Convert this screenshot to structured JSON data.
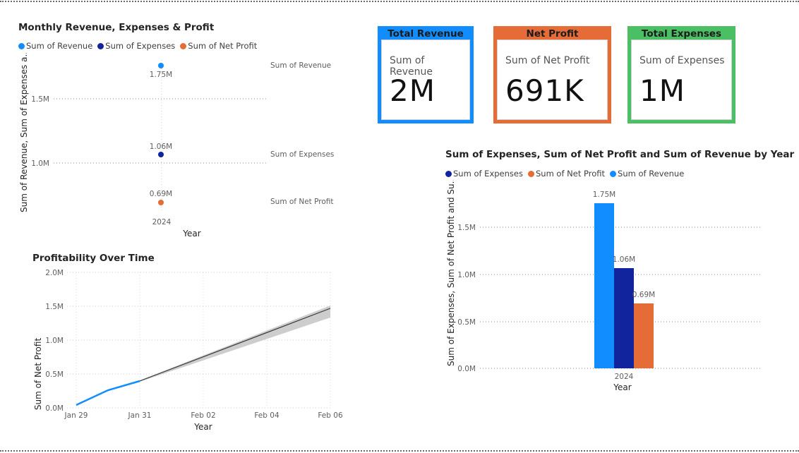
{
  "cards": [
    {
      "title": "Total Revenue",
      "subtitle": "Sum of Revenue",
      "value": "2M",
      "color": "#118dff"
    },
    {
      "title": "Net Profit",
      "subtitle": "Sum of Net Profit",
      "value": "691K",
      "color": "#e66c37"
    },
    {
      "title": "Total Expenses",
      "subtitle": "Sum of Expenses",
      "value": "1M",
      "color": "#4bbf64"
    }
  ],
  "colors": {
    "revenue": "#118dff",
    "expenses": "#12239e",
    "profit": "#e66c37",
    "trend": "#3a3a3a"
  },
  "chart_data": [
    {
      "type": "scatter",
      "title": "Monthly Revenue, Expenses & Profit",
      "legend": [
        "Sum of Revenue",
        "Sum of Expenses",
        "Sum of Net Profit"
      ],
      "legend_position": "top-left",
      "xlabel": "Year",
      "ylabel": "Sum of Revenue, Sum of Expenses a...",
      "categories": [
        "2024"
      ],
      "series": [
        {
          "name": "Sum of Revenue",
          "values": [
            1.75
          ],
          "label": "1.75M"
        },
        {
          "name": "Sum of Expenses",
          "values": [
            1.06
          ],
          "label": "1.06M"
        },
        {
          "name": "Sum of Net Profit",
          "values": [
            0.69
          ],
          "label": "0.69M"
        }
      ],
      "yticks": [
        "1.0M",
        "1.5M"
      ],
      "grid": true
    },
    {
      "type": "line",
      "title": "Profitability Over Time",
      "xlabel": "Year",
      "ylabel": "Sum of Net Profit",
      "x_ticks": [
        "Jan 29",
        "Jan 31",
        "Feb 02",
        "Feb 04",
        "Feb 06"
      ],
      "yticks": [
        "0.0M",
        "0.5M",
        "1.0M",
        "1.5M",
        "2.0M"
      ],
      "ylim": [
        0,
        2.0
      ],
      "series": [
        {
          "name": "Sum of Net Profit",
          "x": [
            "Jan 29",
            "Jan 30",
            "Jan 31"
          ],
          "values": [
            0.04,
            0.26,
            0.4
          ]
        },
        {
          "name": "Forecast",
          "x": [
            "Jan 31",
            "Feb 06"
          ],
          "values": [
            0.4,
            1.46
          ]
        }
      ],
      "grid": true
    },
    {
      "type": "bar",
      "title": "Sum of Expenses, Sum of Net Profit and Sum of Revenue by Year",
      "legend": [
        "Sum of Expenses",
        "Sum of Net Profit",
        "Sum of Revenue"
      ],
      "legend_position": "top-left",
      "xlabel": "Year",
      "ylabel": "Sum of Expenses, Sum of Net Profit and Su...",
      "categories": [
        "2024"
      ],
      "yticks": [
        "0.0M",
        "0.5M",
        "1.0M",
        "1.5M"
      ],
      "ylim": [
        0,
        1.75
      ],
      "series": [
        {
          "name": "Sum of Revenue",
          "values": [
            1.75
          ],
          "label": "1.75M"
        },
        {
          "name": "Sum of Expenses",
          "values": [
            1.06
          ],
          "label": "1.06M"
        },
        {
          "name": "Sum of Net Profit",
          "values": [
            0.69
          ],
          "label": "0.69M"
        }
      ],
      "grid": true
    }
  ]
}
